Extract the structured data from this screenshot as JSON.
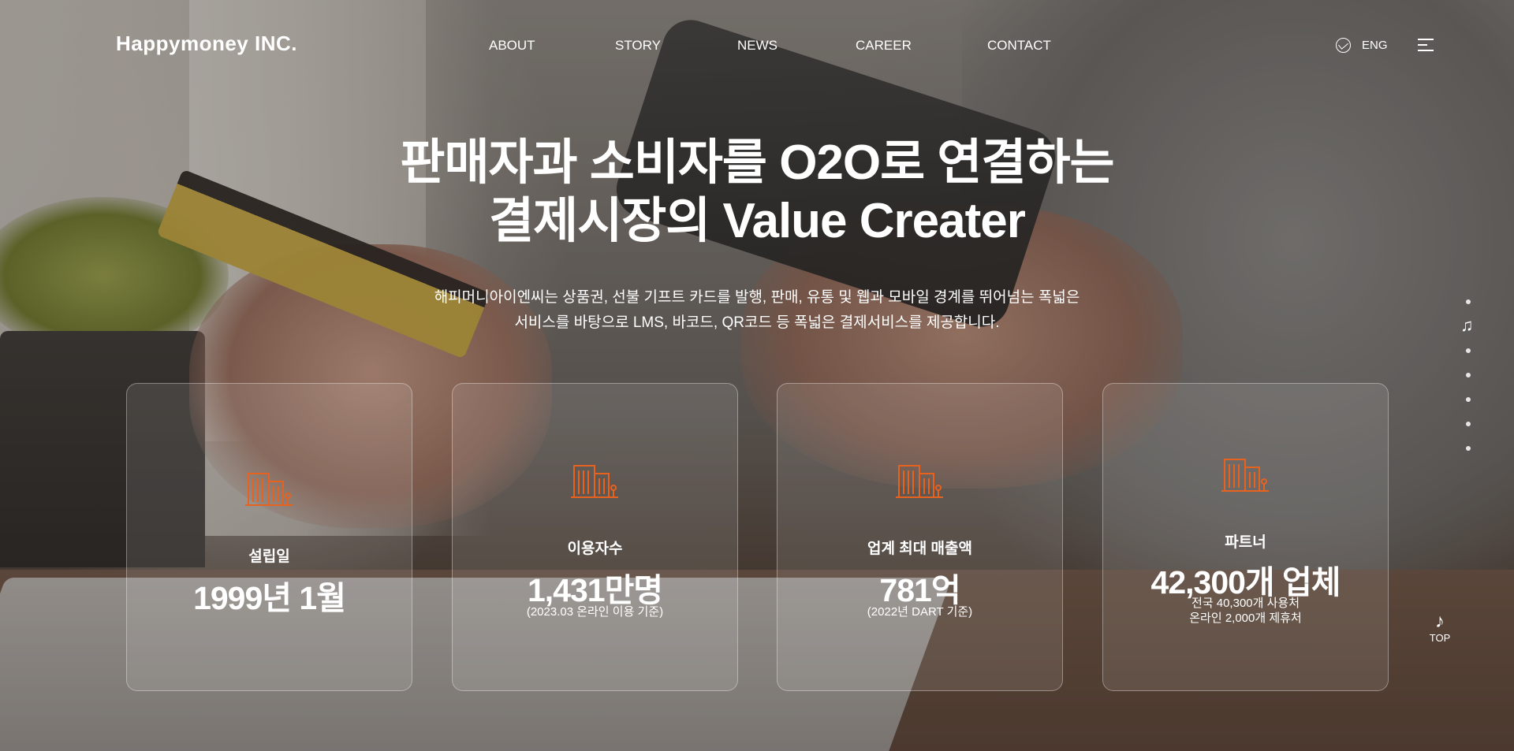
{
  "header": {
    "logo": "Happymoney INC.",
    "nav": [
      "ABOUT",
      "STORY",
      "NEWS",
      "CAREER",
      "CONTACT"
    ],
    "lang": "ENG"
  },
  "hero": {
    "title_line1": "판매자과 소비자를 O2O로 연결하는",
    "title_line2": "결제시장의 Value Creater",
    "desc_line1": "해피머니아이엔씨는 상품권, 선불 기프트 카드를 발행, 판매, 유통 및 웹과 모바일 경계를 뛰어넘는 폭넓은",
    "desc_line2": "서비스를 바탕으로 LMS, 바코드, QR코드 등 폭넓은 결제서비스를 제공합니다."
  },
  "stats": [
    {
      "label": "설립일",
      "value": "1999년 1월"
    },
    {
      "label": "이용자수",
      "value": "1,431만명",
      "note": "(2023.03 온라인 이용 기준)"
    },
    {
      "label": "업계 최대 매출액",
      "value": "781억",
      "note": "(2022년 DART 기준)"
    },
    {
      "label": "파트너",
      "value": "42,300개 업체",
      "note_line1": "전국 40,300개 사용처",
      "note_line2": "온라인 2,000개 제휴처"
    }
  ],
  "side": {
    "top_label": "TOP",
    "note_glyph": "♫",
    "top_glyph": "♪"
  },
  "colors": {
    "accent_orange": "#e8621f",
    "text": "#ffffff"
  },
  "icons": [
    "globe-icon",
    "menu-icon",
    "building-icon",
    "music-note-icon"
  ]
}
